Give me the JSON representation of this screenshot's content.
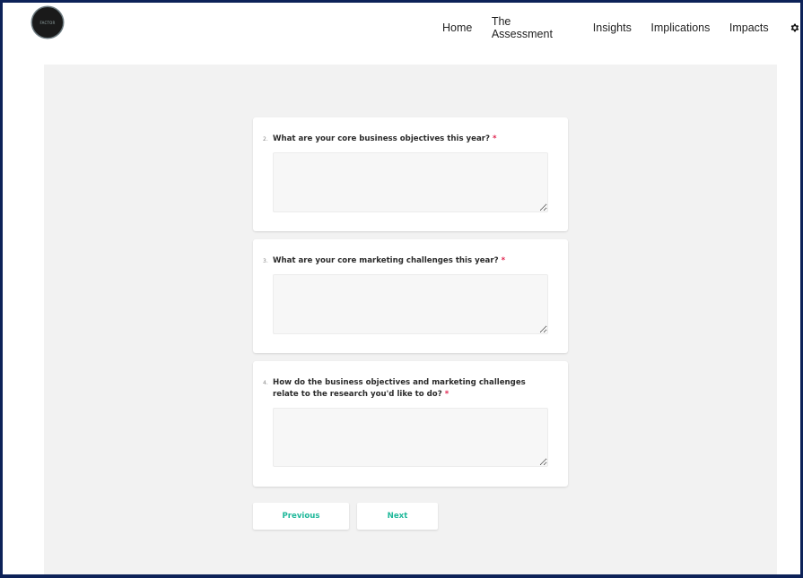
{
  "header": {
    "logo_text": "FACTOR",
    "nav": [
      "Home",
      "The Assessment",
      "Insights",
      "Implications",
      "Impacts"
    ],
    "settings_icon": "gear-icon"
  },
  "form": {
    "required_marker": "*",
    "questions": [
      {
        "number": "2.",
        "text": "What are your core business objectives this year?",
        "value": ""
      },
      {
        "number": "3.",
        "text": "What are your core marketing challenges this year?",
        "value": ""
      },
      {
        "number": "4.",
        "text": "How do the business objectives and marketing challenges relate to the research you'd like to do?",
        "value": ""
      }
    ],
    "previous_label": "Previous",
    "next_label": "Next"
  },
  "colors": {
    "accent": "#1fb89a",
    "required": "#e0244f",
    "frame": "#0d2258"
  }
}
